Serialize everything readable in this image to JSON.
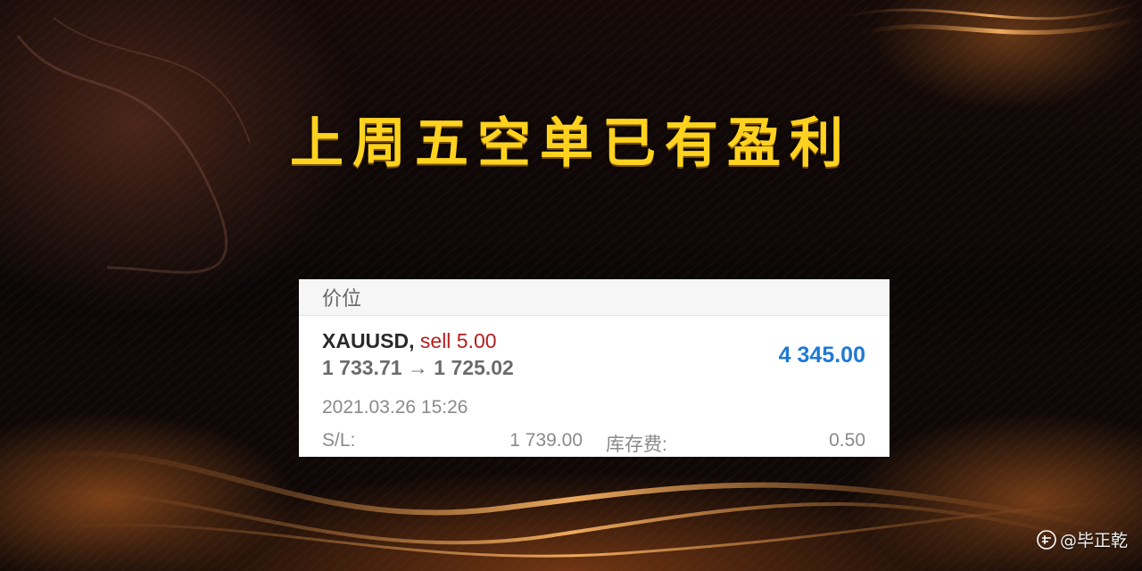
{
  "headline": "上周五空单已有盈利",
  "card": {
    "header_title": "价位",
    "symbol": "XAUUSD,",
    "order": "sell 5.00",
    "price_change": "1 733.71 → 1 725.02",
    "profit": "4 345.00",
    "timestamp": "2021.03.26 15:26",
    "sl_label": "S/L:",
    "sl_value": "1 739.00",
    "swap_label": "库存费:",
    "swap_value": "0.50"
  },
  "watermark": {
    "text": "@毕正乾",
    "logo_icon": "toutiao-logo-icon"
  },
  "colors": {
    "headline": "#ffd21f",
    "sell": "#b41e1e",
    "profit": "#1e79d4"
  }
}
